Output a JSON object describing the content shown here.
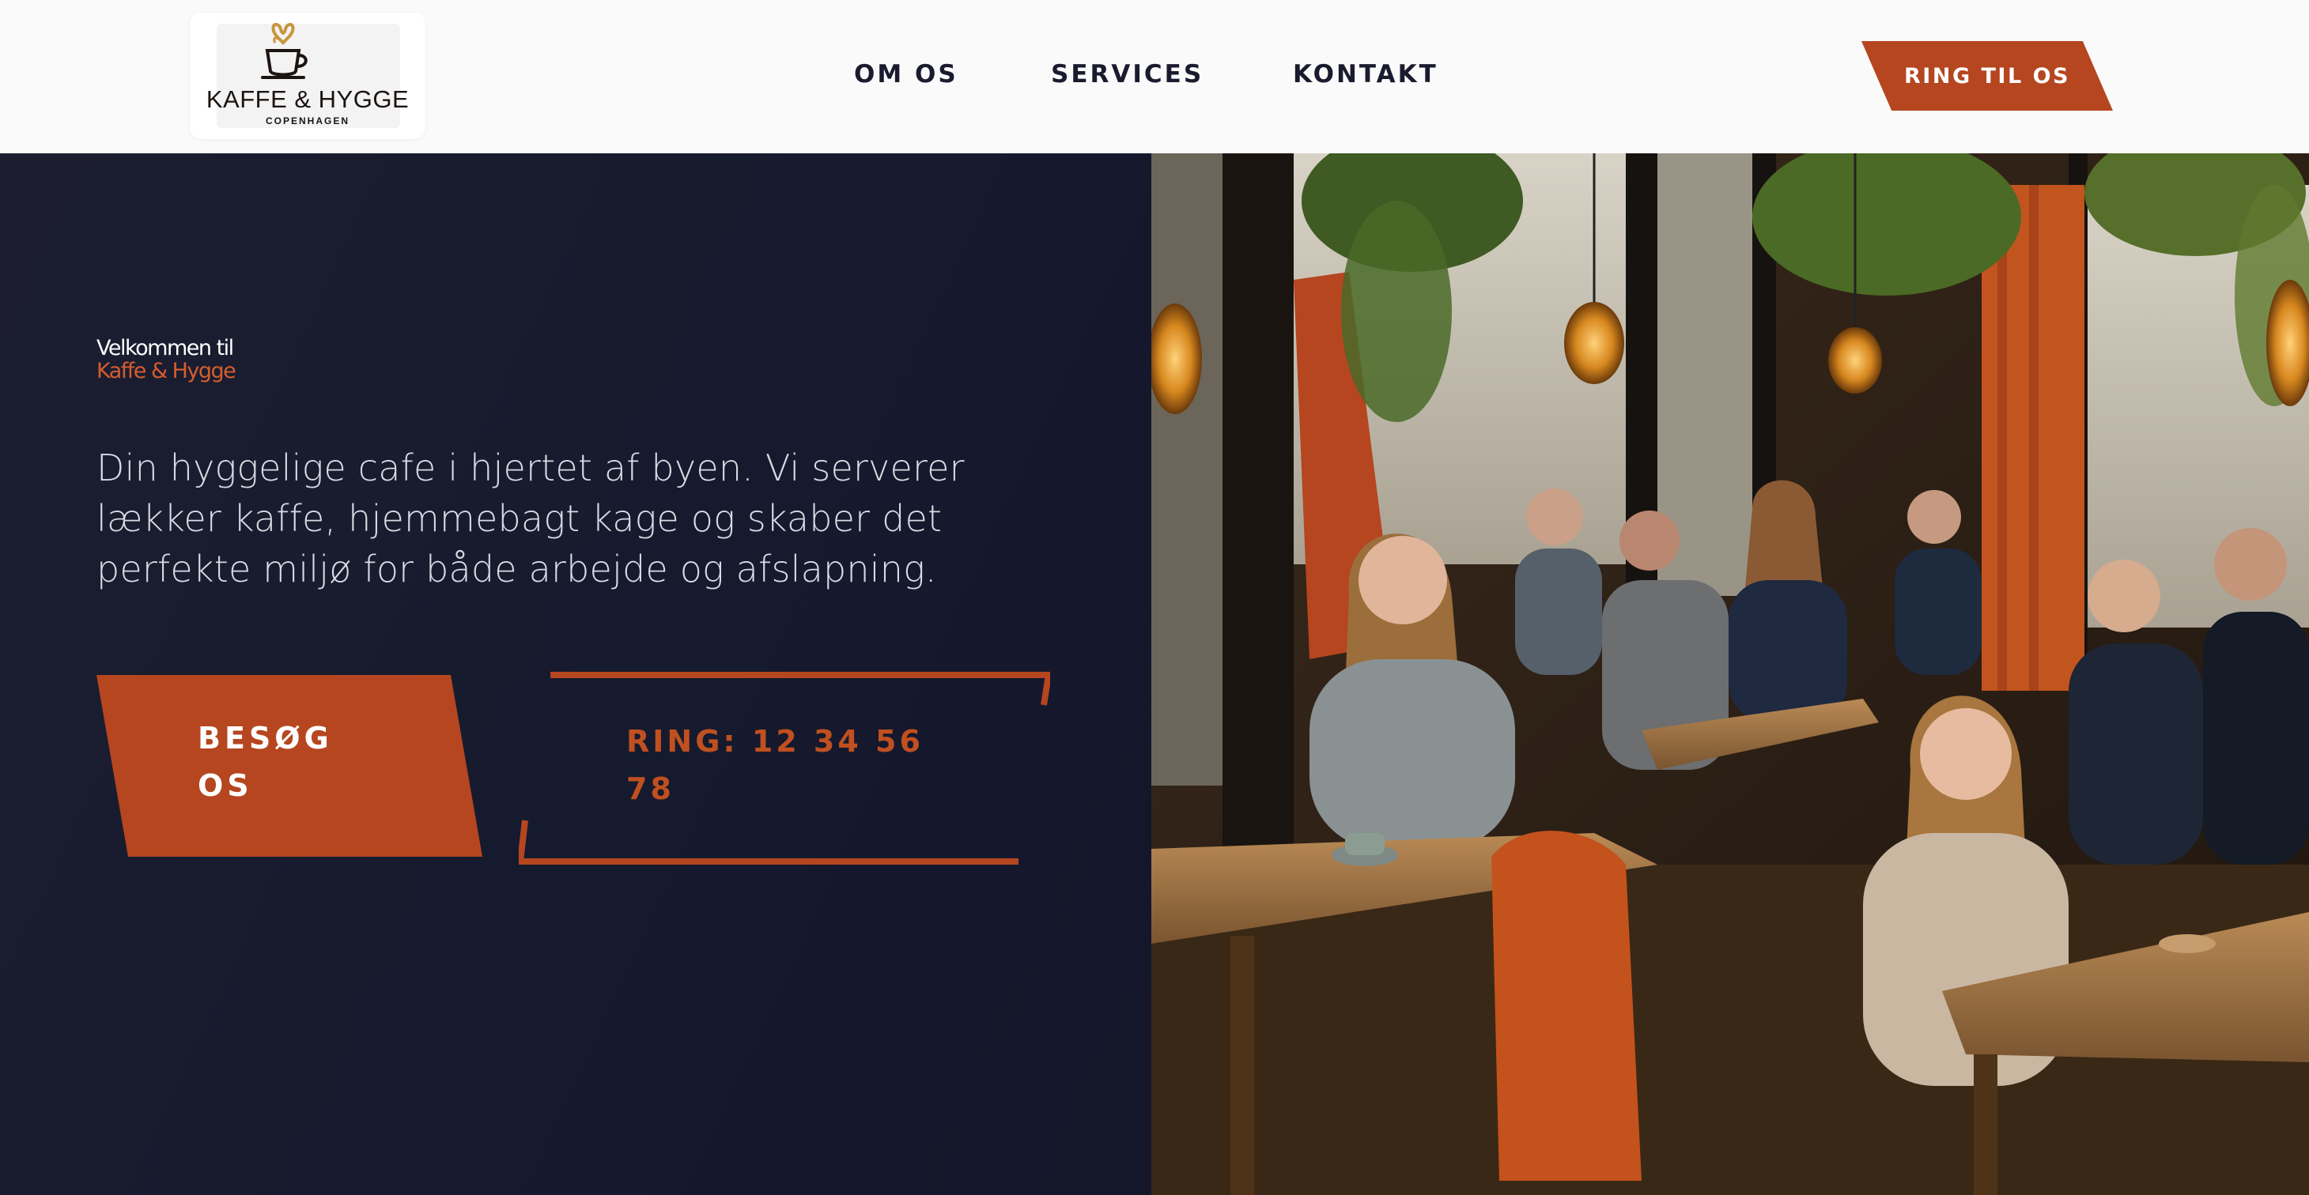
{
  "header": {
    "logo": {
      "title": "KAFFE & HYGGE",
      "subtitle": "COPENHAGEN",
      "icon": "coffee-cup-heart-icon"
    },
    "nav": [
      {
        "label": "OM OS"
      },
      {
        "label": "SERVICES"
      },
      {
        "label": "KONTAKT"
      }
    ],
    "cta_label": "RING TIL OS"
  },
  "hero": {
    "welcome_line1": "Velkommen til",
    "welcome_line2": "Kaffe & Hygge",
    "intro": "Din hyggelige cafe i hjertet af byen. Vi serverer lækker kaffe, hjemmebagt kage og skaber det perfekte miljø for både arbejde og afslapning.",
    "primary_button": "BESØG OS",
    "secondary_button": "RING: 12 34 56 78"
  },
  "colors": {
    "accent": "#b5461f",
    "accent_text": "#d65d2e",
    "hero_bg": "#171a2d",
    "header_bg": "#fafafa",
    "nav_text": "#1a1b2e"
  }
}
